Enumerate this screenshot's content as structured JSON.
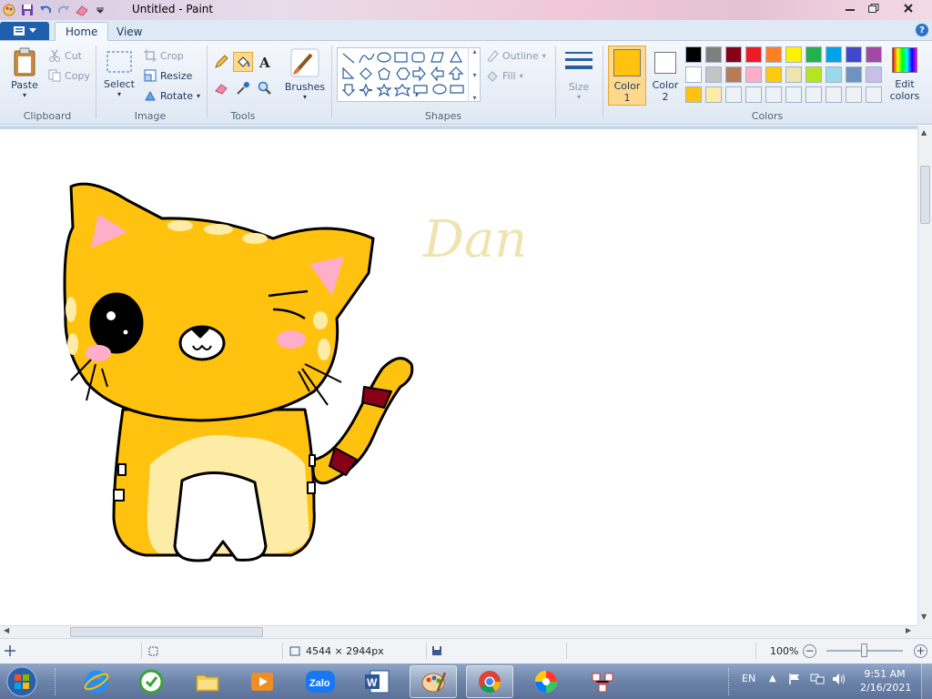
{
  "window": {
    "title": "Untitled - Paint",
    "quick_access": [
      "paint-app-icon",
      "save-icon",
      "undo-icon",
      "redo-icon",
      "eraser-icon",
      "customize-dropdown-icon"
    ],
    "controls": [
      "minimize-icon",
      "maximize-icon",
      "close-icon"
    ]
  },
  "ribbon": {
    "tabs": [
      "Home",
      "View"
    ],
    "active_tab": "Home",
    "clipboard": {
      "paste": "Paste",
      "cut": "Cut",
      "copy": "Copy",
      "label": "Clipboard"
    },
    "image": {
      "select": "Select",
      "crop": "Crop",
      "resize": "Resize",
      "rotate": "Rotate",
      "label": "Image"
    },
    "tools": {
      "label": "Tools"
    },
    "brushes": {
      "label": "Brushes"
    },
    "shapes": {
      "outline": "Outline",
      "fill": "Fill",
      "label": "Shapes"
    },
    "size": {
      "label": "Size"
    },
    "colors": {
      "color1_label": "Color",
      "color1_num": "1",
      "color2_label": "Color",
      "color2_num": "2",
      "color1": "#ffc20e",
      "color2": "#ffffff",
      "edit_label": "Edit",
      "edit_label2": "colors",
      "group_label": "Colors",
      "palette_row1": [
        "#000000",
        "#7f7f7f",
        "#880015",
        "#ed1c24",
        "#ff7f27",
        "#fff200",
        "#22b14c",
        "#00a2e8",
        "#3f48cc",
        "#a349a4"
      ],
      "palette_row2": [
        "#ffffff",
        "#c3c3c3",
        "#b97a57",
        "#ffaec9",
        "#ffc90e",
        "#efe4b0",
        "#b5e61d",
        "#99d9ea",
        "#7092be",
        "#c8bfe7"
      ],
      "palette_row3": [
        "#ffc20e",
        "#fdeca6",
        "",
        "",
        "",
        "",
        "",
        "",
        "",
        ""
      ]
    }
  },
  "canvas": {
    "signature_text": "Dan"
  },
  "statusbar": {
    "dimensions": "4544 × 2944px",
    "zoom": "100%"
  },
  "taskbar": {
    "apps": [
      "Internet Explorer",
      "CCleaner",
      "File Explorer",
      "Media Player",
      "Zalo",
      "Word",
      "Paint",
      "Chrome",
      "Color Picker",
      "Network Tool"
    ],
    "active_app": "Paint",
    "tray": {
      "language": "EN",
      "time": "9:51 AM",
      "date": "2/16/2021"
    }
  }
}
